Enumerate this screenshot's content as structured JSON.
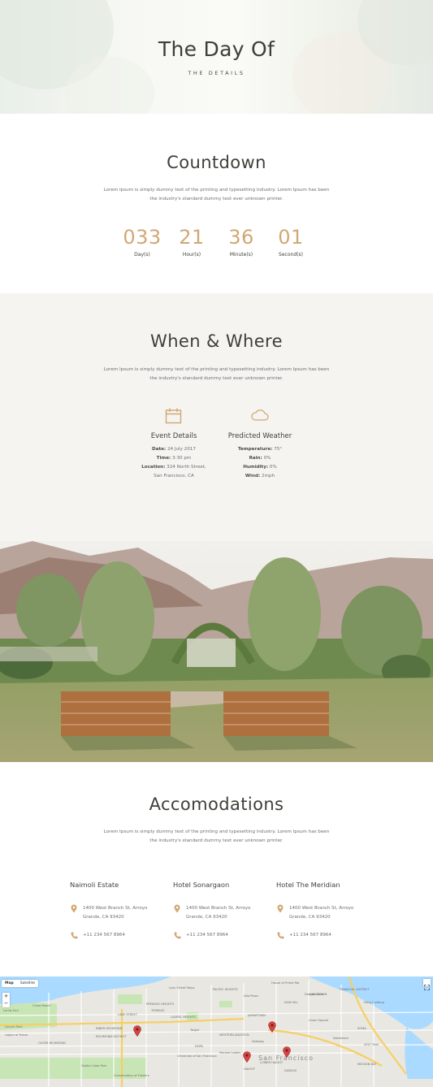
{
  "hero": {
    "title": "The Day Of",
    "subtitle": "THE DETAILS"
  },
  "countdown": {
    "title": "Countdown",
    "description_line1": "Lorem Ipsum is simply dummy text of the printing and typesetting industry. Lorem Ipsum has been",
    "description_line2": "the industry's standard dummy text ever unknown printer.",
    "units": [
      {
        "value": "033",
        "label": "Day(s)"
      },
      {
        "value": "21",
        "label": "Hour(s)"
      },
      {
        "value": "36",
        "label": "Minute(s)"
      },
      {
        "value": "01",
        "label": "Second(s)"
      }
    ]
  },
  "when_where": {
    "title": "When & Where",
    "description_line1": "Lorem Ipsum is simply dummy text of the printing and typesetting industry. Lorem Ipsum has been",
    "description_line2": "the industry's standard dummy text ever unknown printer.",
    "event": {
      "title": "Event Details",
      "icon": "calendar-icon",
      "date_label": "Date:",
      "date_value": "24 July 2017",
      "time_label": "Time:",
      "time_value": "3:30 pm",
      "location_label": "Location:",
      "location_value": "324 North Street,",
      "location_value2": "San Francisco, CA"
    },
    "weather": {
      "title": "Predicted Weather",
      "icon": "cloud-icon",
      "temp_label": "Temperature:",
      "temp_value": "75°",
      "rain_label": "Rain:",
      "rain_value": "0%",
      "humidity_label": "Humidity:",
      "humidity_value": "0%",
      "wind_label": "Wind:",
      "wind_value": "2mph"
    }
  },
  "accommodations": {
    "title": "Accomodations",
    "description_line1": "Lorem Ipsum is simply dummy text of the printing and typesetting industry. Lorem Ipsum has been",
    "description_line2": "the industry's standard dummy text ever unknown printer.",
    "hotels": [
      {
        "name": "Naimoli Estate",
        "address1": "1400 West Branch St, Arroyo",
        "address2": "Grande, CA 93420",
        "phone": "+11 234 567 8964"
      },
      {
        "name": "Hotel Sonargaon",
        "address1": "1400 West Branch St, Arroyo",
        "address2": "Grande, CA 93420",
        "phone": "+11 234 567 8964"
      },
      {
        "name": "Hotel The Meridian",
        "address1": "1400 West Branch St, Arroyo",
        "address2": "Grande, CA 93420",
        "phone": "+11 234 567 8964"
      }
    ]
  },
  "map": {
    "tab_map": "Map",
    "tab_satellite": "Satellite",
    "zoom_in": "+",
    "zoom_out": "−",
    "labels": [
      "Lyon Street Steps",
      "PACIFIC HEIGHTS",
      "Alta Plaza",
      "JAPANTOWN",
      "LAUREL HEIGHTS",
      "PRESIDIO HEIGHTS",
      "LAKE STREET",
      "INNER RICHMOND",
      "RICHMOND DISTRICT",
      "OUTER RICHMOND",
      "Target",
      "University of San Francisco",
      "WESTERN ADDITION",
      "Painted Ladies",
      "FINANCIAL DISTRICT",
      "CHINATOWN",
      "NOB HILL",
      "Dragon Gate",
      "Union Square",
      "SOMA",
      "MISSION BAY",
      "AT&T Park",
      "Golden Gate Park",
      "Legion of Honor",
      "Lincoln Park",
      "China Beach",
      "Lands End",
      "TERRACE",
      "HAIGHT",
      "NOPA",
      "DUBOCE",
      "LOWER HAIGHT",
      "Conservatory of Flowers",
      "Safeway",
      "House of Prime Rib",
      "Nordstrom",
      "Ferry Building"
    ],
    "city": "San Francisco"
  },
  "colors": {
    "accent": "#d1a874",
    "heading": "#3f3f3a",
    "section_bg": "#f6f4f1",
    "pin": "#d64545"
  }
}
